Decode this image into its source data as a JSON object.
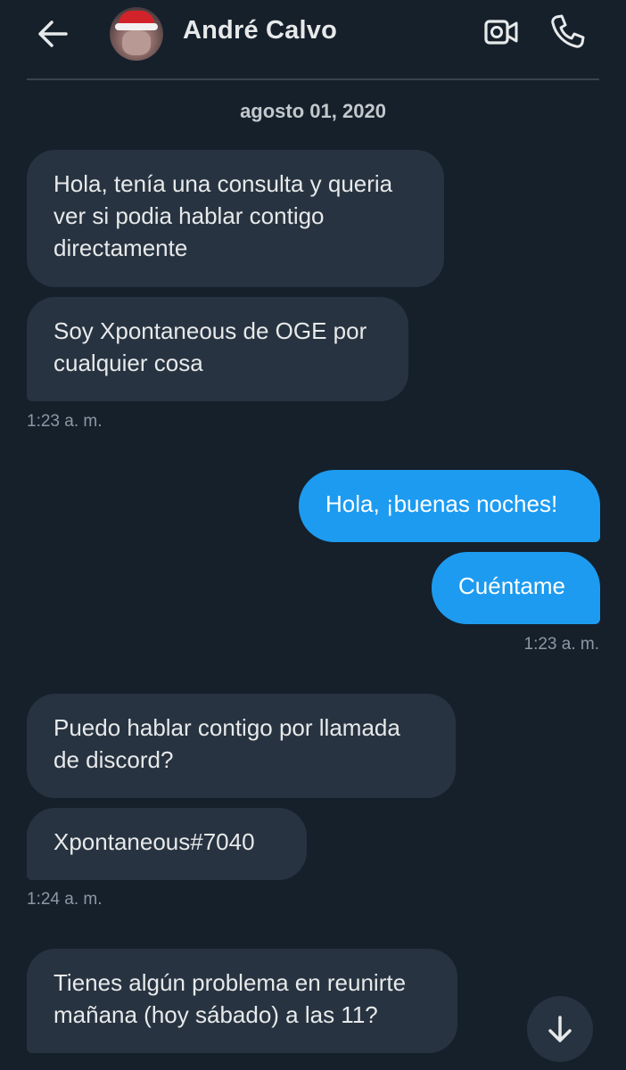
{
  "header": {
    "contact_name": "André Calvo",
    "back_icon": "arrow-left-icon",
    "video_icon": "video-camera-icon",
    "call_icon": "phone-icon"
  },
  "conversation": {
    "date_separator": "agosto 01, 2020",
    "groups": [
      {
        "direction": "incoming",
        "messages": [
          "Hola, tenía una consulta y queria ver si podia hablar contigo directamente",
          "Soy Xpontaneous de OGE por cualquier cosa"
        ],
        "time": "1:23 a. m."
      },
      {
        "direction": "outgoing",
        "messages": [
          "Hola, ¡buenas noches!",
          "Cuéntame"
        ],
        "time": "1:23 a. m."
      },
      {
        "direction": "incoming",
        "messages": [
          "Puedo hablar contigo por llamada de discord?",
          "Xpontaneous#7040"
        ],
        "time": "1:24 a. m."
      },
      {
        "direction": "incoming",
        "messages": [
          "Tienes algún problema en reunirte mañana (hoy sábado) a las 11?"
        ],
        "time": ""
      }
    ]
  },
  "scroll_button_icon": "arrow-down-icon",
  "colors": {
    "background": "#15202b",
    "incoming_bubble": "#273340",
    "outgoing_bubble": "#1d9bf0",
    "timestamp": "#8b98a5"
  }
}
